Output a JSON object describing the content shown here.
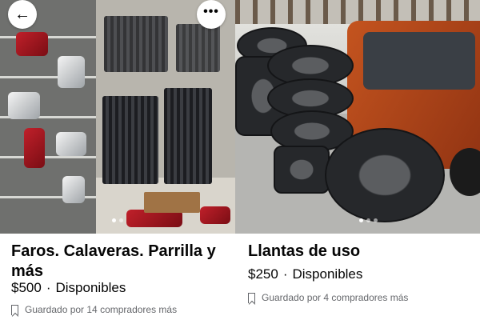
{
  "listings": [
    {
      "title": "Faros. Calaveras. Parrilla y más",
      "price": "$500",
      "separator": "·",
      "availability": "Disponibles",
      "saved_text": "Guardado por 14 compradores más",
      "photo_indicator": {
        "count": 2,
        "active": 1
      }
    },
    {
      "title": "Llantas de uso",
      "price": "$250",
      "separator": "·",
      "availability": "Disponibles",
      "saved_text": "Guardado por 4 compradores más",
      "photo_indicator": {
        "count": 3,
        "active": 1
      }
    }
  ],
  "overlay": {
    "back_icon": "arrow-left-icon",
    "more_icon": "more-horizontal-icon",
    "back_glyph": "←",
    "more_glyph": "•••"
  }
}
